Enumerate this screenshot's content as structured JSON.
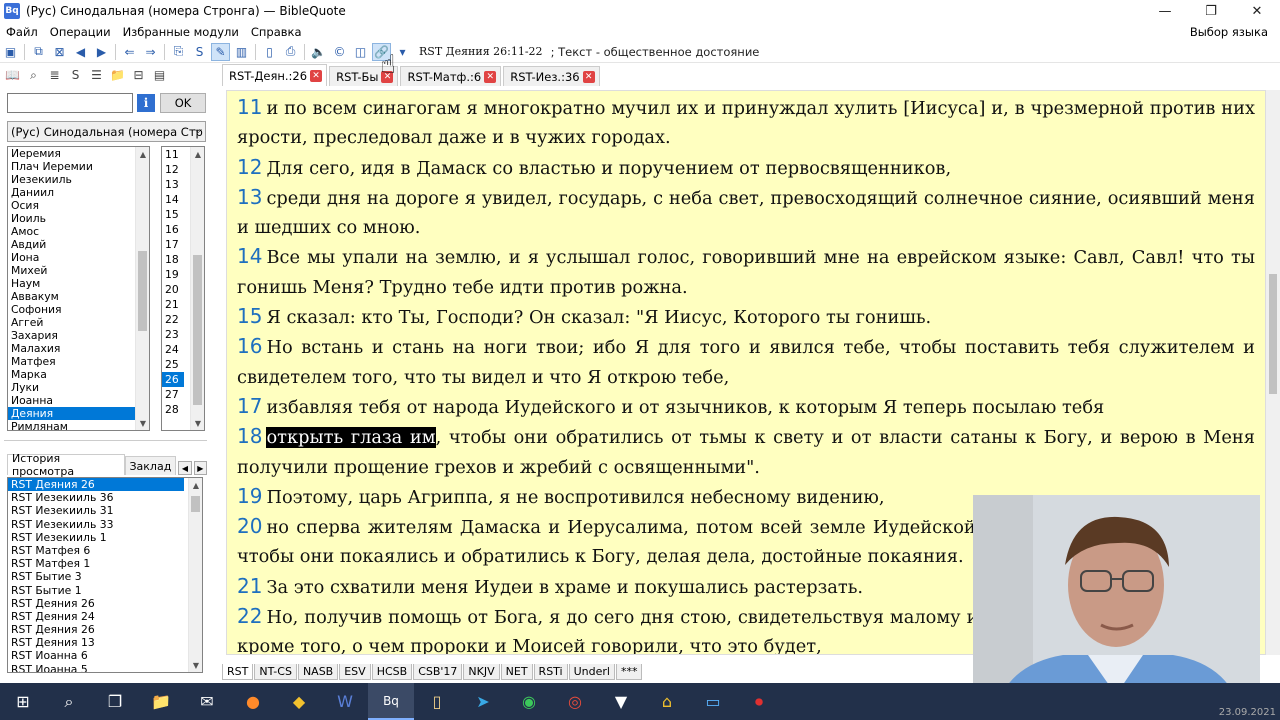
{
  "window": {
    "title": "(Рус) Синодальная (номера Стронга) — BibleQuote",
    "app_icon": "Bq",
    "controls": {
      "minimize": "—",
      "maximize": "❐",
      "close": "✕"
    }
  },
  "menu": {
    "items": [
      "Файл",
      "Операции",
      "Избранные модули",
      "Справка"
    ],
    "right": "Выбор языка"
  },
  "toolbar": {
    "reference": "RST Деяния 26:11-22",
    "info": "; Текст - общественное достояние"
  },
  "search": {
    "value": "",
    "info_label": "i",
    "ok_label": "OK"
  },
  "module_select": {
    "value": "(Рус) Синодальная (номера Стр"
  },
  "books": [
    "Иеремия",
    "Плач Иеремии",
    "Иезекииль",
    "Даниил",
    "Осия",
    "Иоиль",
    "Амос",
    "Авдий",
    "Иона",
    "Михей",
    "Наум",
    "Аввакум",
    "Софония",
    "Аггей",
    "Захария",
    "Малахия",
    "Матфея",
    "Марка",
    "Луки",
    "Иоанна",
    "Деяния",
    "Римлянам"
  ],
  "chapters": [
    "11",
    "12",
    "13",
    "14",
    "15",
    "16",
    "17",
    "18",
    "19",
    "20",
    "21",
    "22",
    "23",
    "24",
    "25",
    "26",
    "27",
    "28"
  ],
  "history_tabs": {
    "history": "История просмотра",
    "bookmarks": "Заклад"
  },
  "history": [
    "RST Деяния 26",
    "RST Иезекииль 36",
    "RST Иезекииль 31",
    "RST Иезекииль 33",
    "RST Иезекииль 1",
    "RST Матфея 6",
    "RST Матфея 1",
    "RST Бытие 3",
    "RST Бытие 1",
    "RST Деяния 26",
    "RST Деяния 24",
    "RST Деяния 26",
    "RST Деяния 13",
    "RST Иоанна 6",
    "RST Иоанна 5"
  ],
  "tabs": [
    {
      "label": "RST-Деян.:26"
    },
    {
      "label": "RST-Бы"
    },
    {
      "label": "RST-Матф.:6"
    },
    {
      "label": "RST-Иез.:36"
    }
  ],
  "verses": [
    {
      "num": "11",
      "text": "и по всем синагогам я многократно мучил их и принуждал хулить [Иисуса] и, в чрезмерной против них ярости, преследовал даже и в чужих городах."
    },
    {
      "num": "12",
      "text": "Для сего, идя в Дамаск со властью и поручением от первосвященников,"
    },
    {
      "num": "13",
      "text": "среди дня на дороге я увидел, государь, с неба свет, превосходящий солнечное сияние, осиявший меня и шедших со мною."
    },
    {
      "num": "14",
      "text": "Все мы упали на землю, и я услышал голос, говоривший мне на еврейском языке: Савл, Савл! что ты гонишь Меня? Трудно тебе идти против рожна."
    },
    {
      "num": "15",
      "text": "Я сказал: кто Ты, Господи? Он сказал: \"Я Иисус, Которого ты гонишь."
    },
    {
      "num": "16",
      "text": "Но встань и стань на ноги твои; ибо Я для того и явился тебе, чтобы поставить тебя служителем и свидетелем того, что ты видел и что Я открою тебе,"
    },
    {
      "num": "17",
      "text": "избавляя тебя от народа Иудейского и от язычников, к которым Я теперь посылаю тебя"
    },
    {
      "num": "18",
      "highlight": "открыть глаза им",
      "text": ", чтобы они обратились от тьмы к свету и от власти сатаны к Богу, и верою в Меня получили прощение грехов и жребий с освященными\"."
    },
    {
      "num": "19",
      "text": "Поэтому, царь Агриппа, я не воспротивился небесному видению,"
    },
    {
      "num": "20",
      "text": "но сперва жителям Дамаска и Иерусалима, потом всей земле Иудейской и язычникам проповедывал, чтобы они покаялись и обратились к Богу, делая дела, достойные покаяния."
    },
    {
      "num": "21",
      "text": "За это схватили меня Иудеи в храме и покушались растерзать."
    },
    {
      "num": "22",
      "text": "Но, получив помощь от Бога, я до сего дня стою, свидетельствуя малому и великому, ничего не говоря, кроме того, о чем пророки и Моисей говорили, что это будет,"
    }
  ],
  "bottom_tabs": [
    "RST",
    "NT-CS",
    "NASB",
    "ESV",
    "HCSB",
    "CSB'17",
    "NKJV",
    "NET",
    "RSTi",
    "Underl",
    "***"
  ],
  "taskbar": {
    "icons": [
      "windows-icon",
      "search-icon",
      "task-view-icon",
      "file-explorer-icon",
      "mail-icon",
      "firefox-icon",
      "maps-icon",
      "writer-icon",
      "biblequote-icon",
      "scroll-icon",
      "telegram-icon",
      "whatsapp-icon",
      "chrome-icon",
      "fox-icon",
      "home-icon",
      "screen-icon",
      "record-icon"
    ],
    "clock": "23.09.2021"
  }
}
